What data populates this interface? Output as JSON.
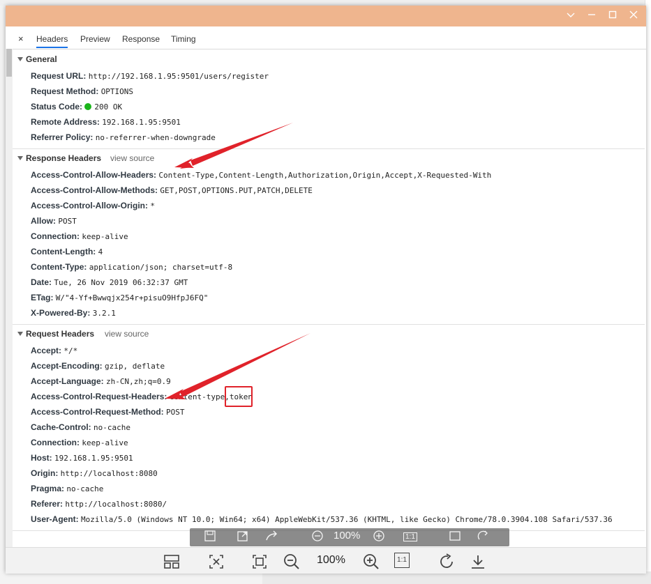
{
  "tabs": {
    "close": "×",
    "items": [
      "Headers",
      "Preview",
      "Response",
      "Timing"
    ]
  },
  "general": {
    "title": "General",
    "rows": [
      {
        "k": "Request URL:",
        "v": "http://192.168.1.95:9501/users/register"
      },
      {
        "k": "Request Method:",
        "v": "OPTIONS"
      },
      {
        "k": "Status Code:",
        "v": "200 OK"
      },
      {
        "k": "Remote Address:",
        "v": "192.168.1.95:9501"
      },
      {
        "k": "Referrer Policy:",
        "v": "no-referrer-when-downgrade"
      }
    ]
  },
  "response_headers": {
    "title": "Response Headers",
    "view_source": "view source",
    "rows": [
      {
        "k": "Access-Control-Allow-Headers:",
        "v": "Content-Type,Content-Length,Authorization,Origin,Accept,X-Requested-With"
      },
      {
        "k": "Access-Control-Allow-Methods:",
        "v": "GET,POST,OPTIONS.PUT,PATCH,DELETE"
      },
      {
        "k": "Access-Control-Allow-Origin:",
        "v": "*"
      },
      {
        "k": "Allow:",
        "v": "POST"
      },
      {
        "k": "Connection:",
        "v": "keep-alive"
      },
      {
        "k": "Content-Length:",
        "v": "4"
      },
      {
        "k": "Content-Type:",
        "v": "application/json; charset=utf-8"
      },
      {
        "k": "Date:",
        "v": "Tue, 26 Nov 2019 06:32:37 GMT"
      },
      {
        "k": "ETag:",
        "v": "W/\"4-Yf+Bwwqjx254r+pisuO9HfpJ6FQ\""
      },
      {
        "k": "X-Powered-By:",
        "v": "3.2.1"
      }
    ]
  },
  "request_headers": {
    "title": "Request Headers",
    "view_source": "view source",
    "rows": [
      {
        "k": "Accept:",
        "v": "*/*"
      },
      {
        "k": "Accept-Encoding:",
        "v": "gzip, deflate"
      },
      {
        "k": "Accept-Language:",
        "v": "zh-CN,zh;q=0.9"
      },
      {
        "k": "Access-Control-Request-Headers:",
        "v": "content-type,token"
      },
      {
        "k": "Access-Control-Request-Method:",
        "v": "POST"
      },
      {
        "k": "Cache-Control:",
        "v": "no-cache"
      },
      {
        "k": "Connection:",
        "v": "keep-alive"
      },
      {
        "k": "Host:",
        "v": "192.168.1.95:9501"
      },
      {
        "k": "Origin:",
        "v": "http://localhost:8080"
      },
      {
        "k": "Pragma:",
        "v": "no-cache"
      },
      {
        "k": "Referer:",
        "v": "http://localhost:8080/"
      },
      {
        "k": "User-Agent:",
        "v": "Mozilla/5.0 (Windows NT 10.0; Win64; x64) AppleWebKit/537.36 (KHTML, like Gecko) Chrome/78.0.3904.108 Safari/537.36"
      }
    ]
  },
  "viewer": {
    "zoom": "100%",
    "ghost_zoom": "100%",
    "one_to_one": "1:1"
  },
  "colors": {
    "titlebar": "#efb58e",
    "annotation_red": "#e0222a",
    "active_tab": "#1a73e8",
    "status_green": "#1bb51b"
  }
}
